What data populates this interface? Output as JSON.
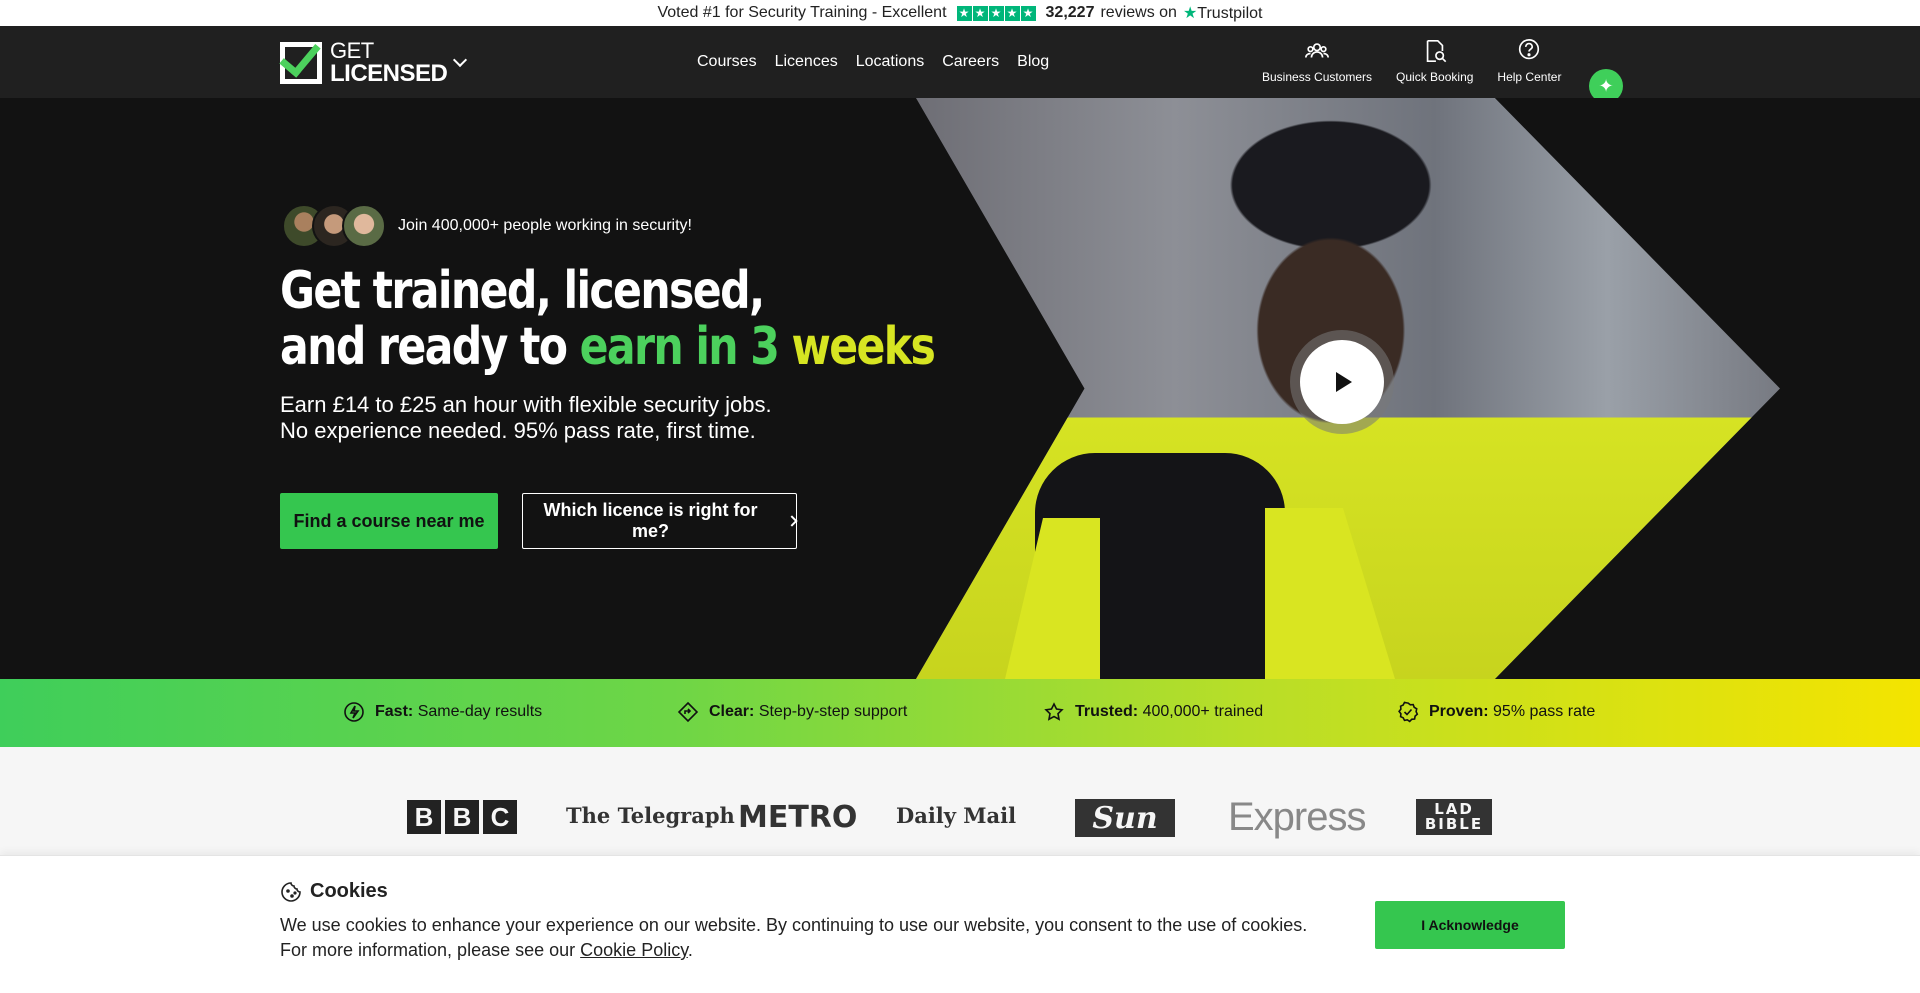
{
  "topbar": {
    "text": "Voted #1 for Security Training - Excellent",
    "rating_stars": 5,
    "review_count": "32,227",
    "reviews_on": "reviews on",
    "trustpilot": "Trustpilot",
    "trustpilot_color": "#00b67a"
  },
  "header": {
    "logo_line1": "GET",
    "logo_line2": "LICENSED",
    "nav": [
      "Courses",
      "Licences",
      "Locations",
      "Careers",
      "Blog"
    ],
    "actions": {
      "business": "Business Customers",
      "quick_booking": "Quick Booking",
      "help": "Help Center"
    },
    "background": "#202020"
  },
  "hero": {
    "join_text": "Join 400,000+ people working in security!",
    "title_line1": "Get trained, licensed,",
    "title_line2_prefix": "and ready to",
    "title_line2_green": "earn in 3",
    "title_line2_yellow": "weeks",
    "subtitle_line1": "Earn £14 to £25 an hour with flexible security jobs.",
    "subtitle_line2": "No experience needed. 95% pass rate, first time.",
    "primary_button": "Find a course near me",
    "secondary_button": "Which licence is right for me?",
    "accent_green": "#4cd15d",
    "accent_yellow": "#d7e522"
  },
  "features": [
    {
      "bold": "Fast:",
      "text": "Same-day results",
      "icon": "lightning-icon"
    },
    {
      "bold": "Clear:",
      "text": "Step-by-step support",
      "icon": "diamond-arrow-icon"
    },
    {
      "bold": "Trusted:",
      "text": "400,000+ trained",
      "icon": "star-badge-icon"
    },
    {
      "bold": "Proven:",
      "text": "95% pass rate",
      "icon": "check-badge-icon"
    }
  ],
  "press": {
    "bbc": [
      "B",
      "B",
      "C"
    ],
    "telegraph": "The Telegraph",
    "metro": "METRO",
    "dailymail": "Daily Mail",
    "sun": "Sun",
    "express": "Express",
    "ladbible_line1": "LAD",
    "ladbible_line2": "BIBLE"
  },
  "cookie": {
    "title": "Cookies",
    "text_line1": "We use cookies to enhance your experience on our website. By continuing to use our website, you consent to the use of cookies.",
    "text_line2_prefix": "For more information, please see our",
    "link": "Cookie Policy",
    "text_line2_suffix": ".",
    "button": "I Acknowledge"
  }
}
